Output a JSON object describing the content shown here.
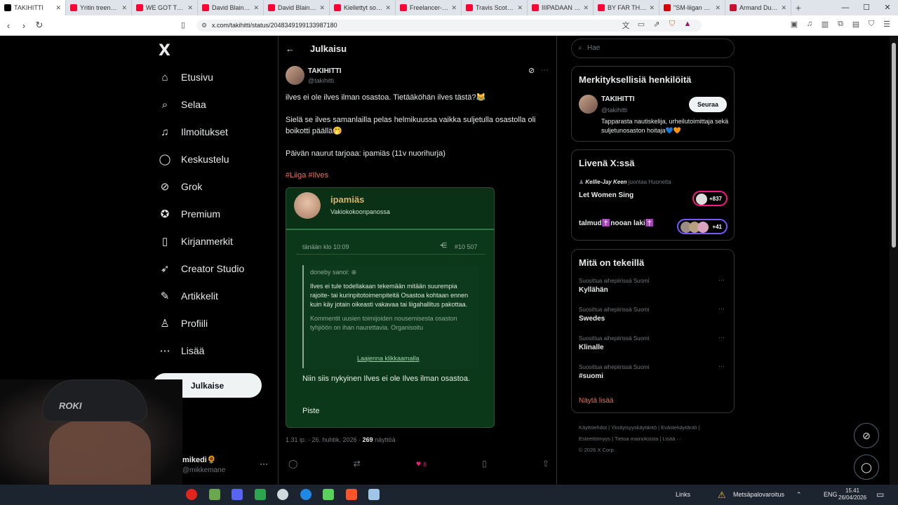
{
  "browser": {
    "tabs": [
      {
        "label": "TAKIHITTI",
        "color": "#000000",
        "active": true
      },
      {
        "label": "Yritin treenata pa",
        "color": "#ff0033"
      },
      {
        "label": "WE GOT TRAPPED",
        "color": "#ff0033"
      },
      {
        "label": "David Blaine: Do I",
        "color": "#ff0033"
      },
      {
        "label": "David Blaine: Da",
        "color": "#ff0033"
      },
      {
        "label": "Kiellettyt soinduti",
        "color": "#ff0033"
      },
      {
        "label": "Freelancer-Zomb",
        "color": "#ff0033"
      },
      {
        "label": "Travis Scott - MO",
        "color": "#ff0033"
      },
      {
        "label": "IIIPADAAN shoks",
        "color": "#ff0033"
      },
      {
        "label": "BY FAR THE SCAI",
        "color": "#ff0033"
      },
      {
        "label": "\"SM-liigan paras",
        "color": "#d40000"
      },
      {
        "label": "Armand Duplantis",
        "color": "#c8102e"
      }
    ],
    "url": "x.com/takihitti/status/2048349199133987180"
  },
  "sidebar": {
    "logo": "X",
    "items": [
      {
        "label": "Etusivu",
        "icon": "home-icon",
        "glyph": "⌂"
      },
      {
        "label": "Selaa",
        "icon": "search-icon",
        "glyph": "⌕"
      },
      {
        "label": "Ilmoitukset",
        "icon": "bell-icon",
        "glyph": "♫"
      },
      {
        "label": "Keskustelu",
        "icon": "chat-icon",
        "glyph": "◯"
      },
      {
        "label": "Grok",
        "icon": "grok-icon",
        "glyph": "⊘"
      },
      {
        "label": "Premium",
        "icon": "premium-icon",
        "glyph": "✪"
      },
      {
        "label": "Kirjanmerkit",
        "icon": "bookmark-icon",
        "glyph": "▯"
      },
      {
        "label": "Creator Studio",
        "icon": "rocket-icon",
        "glyph": "➶"
      },
      {
        "label": "Artikkelit",
        "icon": "article-icon",
        "glyph": "✎"
      },
      {
        "label": "Profiili",
        "icon": "profile-icon",
        "glyph": "♙"
      },
      {
        "label": "Lisää",
        "icon": "more-icon",
        "glyph": "⋯"
      }
    ],
    "post_button": "Julkaise",
    "account": {
      "name": "mikedi🌻",
      "handle": "@mikkemane"
    },
    "webcam_cap_text": "ROKI"
  },
  "main": {
    "header": "Julkaisu",
    "tweet": {
      "name": "TAKIHITTI",
      "handle": "@takihitti",
      "p1": "ilves ei ole ilves ilman osastoa. Tietääköhän ilves tästä?😹",
      "p2": "Sielä se ilves samanlailla pelas helmikuussa vaikka suljetulla osastolla oli boikotti päällä🤭",
      "p3": "Päivän naurut tarjoaa: ipamiäs (11v nuorihurja)",
      "tags": "#Liiga #Ilves",
      "card": {
        "name": "ipamiäs",
        "rank": "Vakiokokoonpanossa",
        "time": "tänään klo 10:09",
        "number": "#10 507",
        "quote_head": "doneby sanoi:",
        "quote_text": "Ilves ei tule todellakaan tekemään mitään suurempia rajoite- tai kurinpitotoimenpiteitä Osastoa kohtaan ennen kuin käy jotain oikeasti vakavaa tai liigahallitus pakottaa.",
        "quote_text2": "Kommentit uusien toimijoiden nousemisesta osaston tyhjiöön on ihan naurettavia. Organisoitu",
        "expand": "Laajenna klikkaamalla",
        "body": "Niin siis nykyinen Ilves ei ole Ilves ilman osastoa.",
        "sign": "Piste"
      },
      "meta_prefix": "1.31 ip. · 26. huhtik. 2026 · ",
      "views": "269",
      "meta_suffix": " näyttöä",
      "likes": "8"
    }
  },
  "right": {
    "search_placeholder": "Hae",
    "relevant": {
      "title": "Merkityksellisiä henkilöitä",
      "name": "TAKIHITTI",
      "handle": "@takihitti",
      "follow": "Seuraa",
      "bio": "Tapparasta nautiskelija, urheilutoimittaja sekä suljetunosaston hoitaja💙🧡"
    },
    "live": {
      "title": "Livenä X:ssä",
      "host": "Kellie-Jay Keen",
      "host_suffix": "juontaa Huonetta",
      "space1": "Let Women Sing",
      "space1_count": "+837",
      "space2": "talmud✝️nooan laki✝️",
      "space2_count": "+41"
    },
    "trending": {
      "title": "Mitä on tekeillä",
      "items": [
        {
          "context": "Suosittua aihepiirissä Suomi",
          "topic": "Kyllähän"
        },
        {
          "context": "Suosittua aihepiirissä Suomi",
          "topic": "Swedes"
        },
        {
          "context": "Suosittua aihepiirissä Suomi",
          "topic": "Klinalle"
        },
        {
          "context": "Suosittua aihepiirissä Suomi",
          "topic": "#suomi"
        }
      ],
      "show_more": "Näytä lisää"
    },
    "footer": {
      "l1": "Käyttöehdot",
      "l2": "Yksityisyyskäytäntö",
      "l3": "Evästekäytäntö",
      "l4": "Esteettömyys",
      "l5": "Tietoa mainoksista",
      "l6": "Lisää ···",
      "copyright": "© 2026 X Corp."
    }
  },
  "taskbar": {
    "links": "Links",
    "alert": "Metsäpalovaroitus",
    "lang": "ENG",
    "time": "15.41",
    "date": "26/04/2026"
  }
}
